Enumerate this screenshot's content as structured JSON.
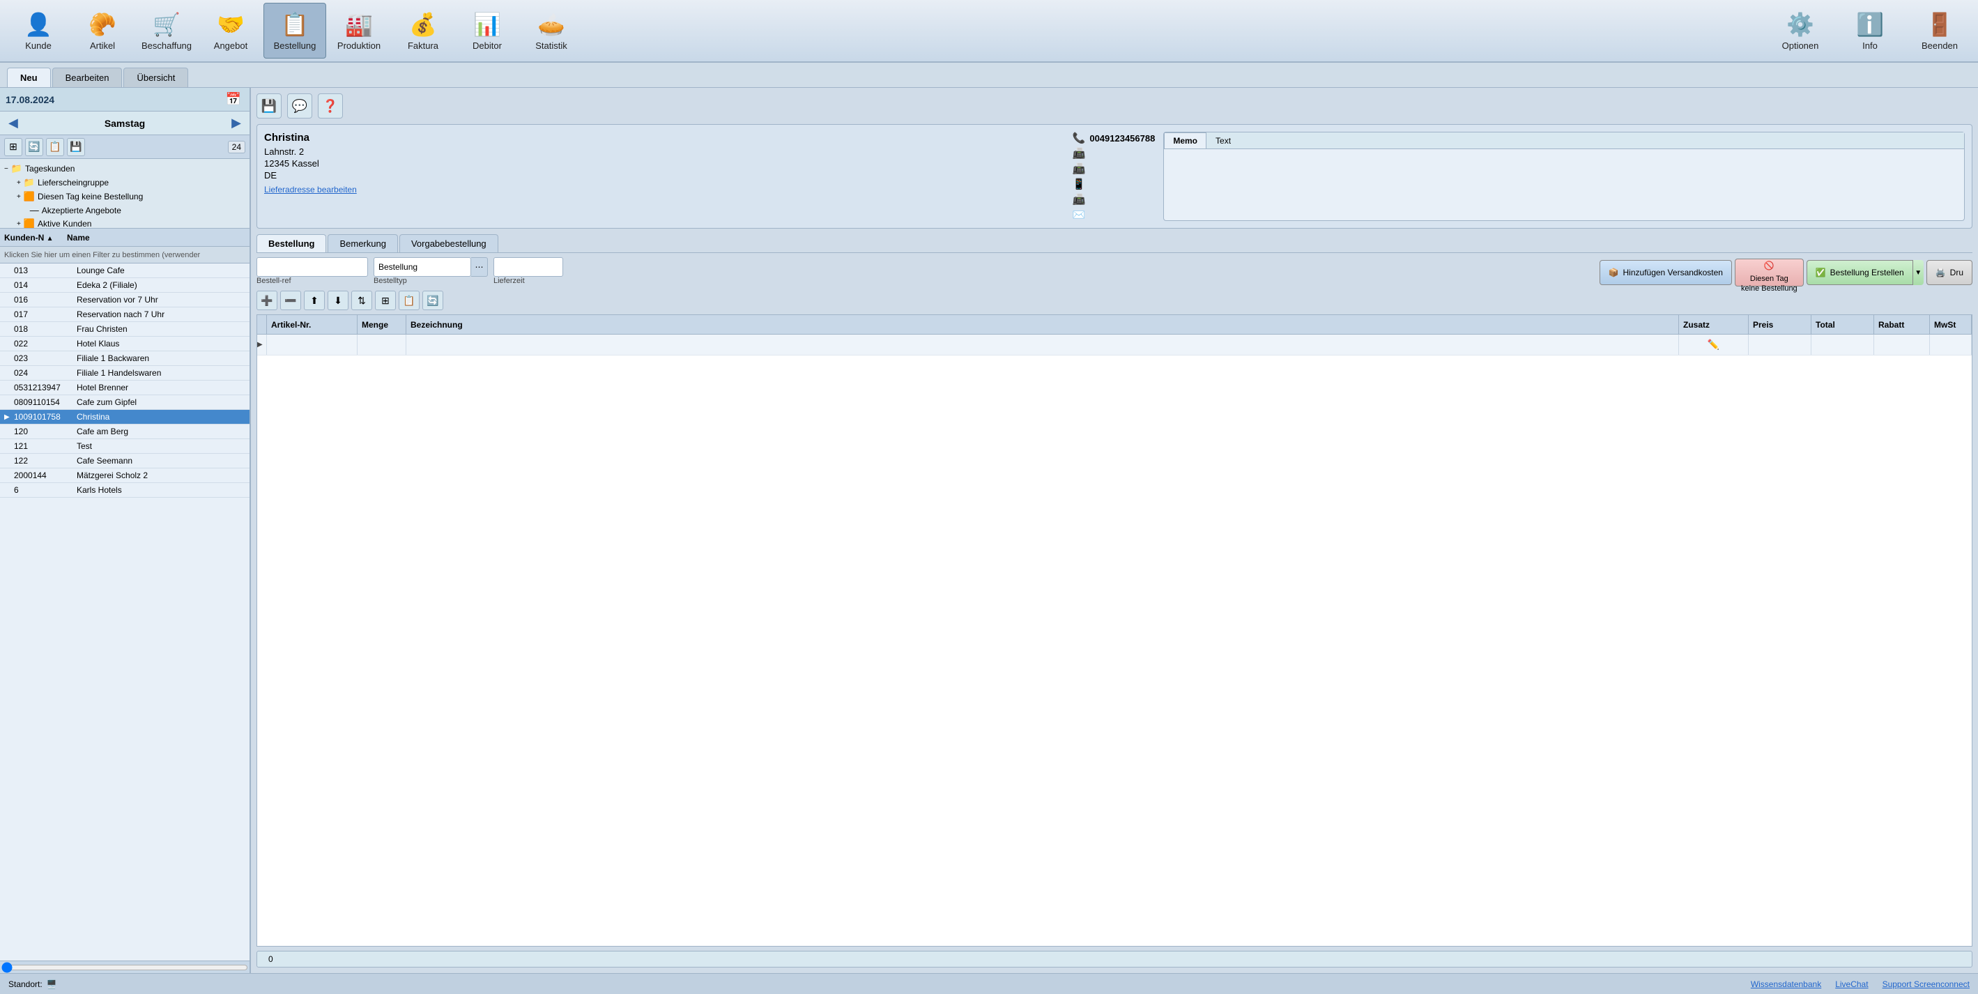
{
  "toolbar": {
    "items": [
      {
        "id": "kunde",
        "label": "Kunde",
        "icon": "👤"
      },
      {
        "id": "artikel",
        "label": "Artikel",
        "icon": "🥐"
      },
      {
        "id": "beschaffung",
        "label": "Beschaffung",
        "icon": "🛒"
      },
      {
        "id": "angebot",
        "label": "Angebot",
        "icon": "🤝"
      },
      {
        "id": "bestellung",
        "label": "Bestellung",
        "icon": "📋",
        "active": true
      },
      {
        "id": "produktion",
        "label": "Produktion",
        "icon": "🏭"
      },
      {
        "id": "faktura",
        "label": "Faktura",
        "icon": "💰"
      },
      {
        "id": "debitor",
        "label": "Debitor",
        "icon": "📊"
      },
      {
        "id": "statistik",
        "label": "Statistik",
        "icon": "🥧"
      }
    ],
    "right_items": [
      {
        "id": "optionen",
        "label": "Optionen",
        "icon": "⚙️"
      },
      {
        "id": "info",
        "label": "Info",
        "icon": "ℹ️"
      },
      {
        "id": "beenden",
        "label": "Beenden",
        "icon": "🚪"
      }
    ]
  },
  "tabs": [
    {
      "id": "neu",
      "label": "Neu",
      "active": true
    },
    {
      "id": "bearbeiten",
      "label": "Bearbeiten"
    },
    {
      "id": "uebersicht",
      "label": "Übersicht"
    }
  ],
  "left_panel": {
    "date": "17.08.2024",
    "day": "Samstag",
    "badge": "24",
    "tree": [
      {
        "label": "Tageskunden",
        "icon": "📁",
        "level": 0,
        "expand": "−"
      },
      {
        "label": "Lieferscheingruppe",
        "icon": "📁",
        "level": 1,
        "expand": "+"
      },
      {
        "label": "Diesen Tag keine Bestellung",
        "icon": "🟧",
        "level": 1,
        "expand": "+"
      },
      {
        "label": "Akzeptierte Angebote",
        "icon": "—",
        "level": 1,
        "expand": ""
      },
      {
        "label": "Aktive Kunden",
        "icon": "🟧",
        "level": 1,
        "expand": "+"
      }
    ],
    "columns": [
      {
        "id": "kunden_nr",
        "label": "Kunden-N",
        "sort": "▲"
      },
      {
        "id": "name",
        "label": "Name"
      }
    ],
    "filter_text": "Klicken Sie hier um einen Filter zu bestimmen (verwender",
    "customers": [
      {
        "id": "013",
        "name": "Lounge Cafe",
        "selected": false
      },
      {
        "id": "014",
        "name": "Edeka 2 (Filiale)",
        "selected": false
      },
      {
        "id": "016",
        "name": "Reservation vor 7 Uhr",
        "selected": false
      },
      {
        "id": "017",
        "name": "Reservation nach 7 Uhr",
        "selected": false
      },
      {
        "id": "018",
        "name": "Frau Christen",
        "selected": false
      },
      {
        "id": "022",
        "name": "Hotel Klaus",
        "selected": false
      },
      {
        "id": "023",
        "name": "Filiale 1 Backwaren",
        "selected": false
      },
      {
        "id": "024",
        "name": "Filiale 1 Handelswaren",
        "selected": false
      },
      {
        "id": "0531213947",
        "name": "Hotel Brenner",
        "selected": false
      },
      {
        "id": "0809110154",
        "name": "Cafe zum Gipfel",
        "selected": false
      },
      {
        "id": "1009101758",
        "name": "Christina",
        "selected": true
      },
      {
        "id": "120",
        "name": "Cafe am Berg",
        "selected": false
      },
      {
        "id": "121",
        "name": "Test",
        "selected": false
      },
      {
        "id": "122",
        "name": "Cafe Seemann",
        "selected": false
      },
      {
        "id": "2000144",
        "name": "Mätzgerei Scholz 2",
        "selected": false
      },
      {
        "id": "6",
        "name": "Karls Hotels",
        "selected": false
      }
    ]
  },
  "customer_detail": {
    "name": "Christina",
    "address1": "Lahnstr. 2",
    "address2": "12345 Kassel",
    "country": "DE",
    "phone": "0049123456788",
    "phone_icon": "📞",
    "fax_icon": "📠",
    "mobile_icon": "📱",
    "fax2_icon": "📠",
    "link_label": "Lieferadresse bearbeiten",
    "email_icon": "✉️"
  },
  "memo": {
    "tabs": [
      {
        "id": "memo",
        "label": "Memo",
        "active": true
      },
      {
        "id": "text",
        "label": "Text"
      }
    ],
    "content": ""
  },
  "order_tabs": [
    {
      "id": "bestellung",
      "label": "Bestellung",
      "active": true
    },
    {
      "id": "bemerkung",
      "label": "Bemerkung"
    },
    {
      "id": "vorgabebestellung",
      "label": "Vorgabebestellung"
    }
  ],
  "order_form": {
    "bestell_ref_label": "Bestell-ref",
    "bestell_ref_value": "",
    "bestelltyp_label": "Bestelltyp",
    "bestelltyp_value": "Bestellung",
    "lieferzeit_label": "Lieferzeit",
    "lieferzeit_value": ""
  },
  "order_buttons": {
    "versandkosten": "Hinzufügen Versandkosten",
    "keine_bestellung": "Diesen Tag\nkeine Bestellung",
    "bestellung_erstellen": "Bestellung Erstellen",
    "drucken": "Dru"
  },
  "table": {
    "headers": [
      {
        "id": "artikel_nr",
        "label": "Artikel-Nr."
      },
      {
        "id": "menge",
        "label": "Menge"
      },
      {
        "id": "bezeichnung",
        "label": "Bezeichnung"
      },
      {
        "id": "zusatz",
        "label": "Zusatz"
      },
      {
        "id": "preis",
        "label": "Preis"
      },
      {
        "id": "total",
        "label": "Total"
      },
      {
        "id": "rabatt",
        "label": "Rabatt"
      },
      {
        "id": "mwst",
        "label": "MwSt"
      }
    ],
    "rows": []
  },
  "progress": {
    "value": 0,
    "label": "0"
  },
  "status_bar": {
    "standort_label": "Standort:",
    "standort_icon": "🖥️",
    "links": [
      {
        "id": "wissensdatenbank",
        "label": "Wissensdatenbank"
      },
      {
        "id": "livechat",
        "label": "LiveChat"
      },
      {
        "id": "support",
        "label": "Support Screenconnect"
      }
    ]
  }
}
